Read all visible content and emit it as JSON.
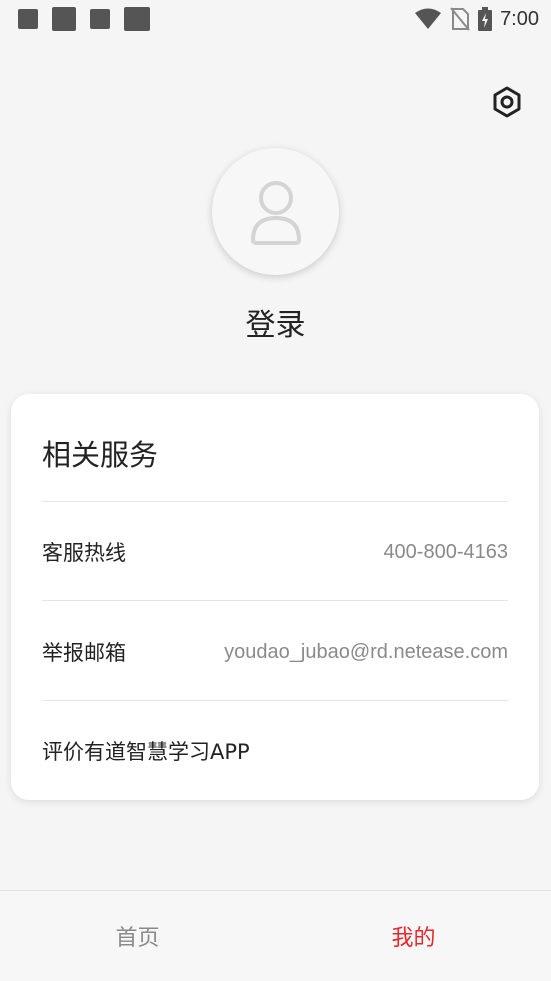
{
  "status_bar": {
    "time": "7:00",
    "icons": [
      "notification-square",
      "notification-square",
      "notification-square",
      "notification-square",
      "wifi-icon",
      "no-sim-icon",
      "battery-charging-icon"
    ]
  },
  "header": {
    "settings_icon": "gear-icon"
  },
  "profile": {
    "avatar_icon": "user-silhouette-icon",
    "login_label": "登录"
  },
  "services": {
    "title": "相关服务",
    "hotline": {
      "label": "客服热线",
      "value": "400-800-4163"
    },
    "report": {
      "label": "举报邮箱",
      "value": "youdao_jubao@rd.netease.com"
    },
    "rate": {
      "label": "评价有道智慧学习APP"
    }
  },
  "nav": {
    "home": "首页",
    "mine": "我的",
    "active_color": "#e8262c",
    "inactive_color": "#8a8a8a"
  }
}
